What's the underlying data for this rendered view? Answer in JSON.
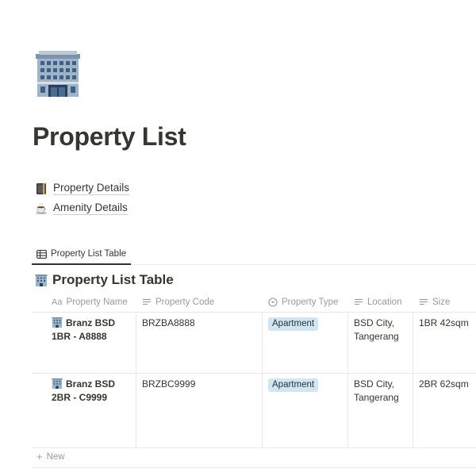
{
  "page": {
    "icon": "office-building-icon",
    "title": "Property List"
  },
  "links": [
    {
      "icon": "ledger-icon",
      "label": "Property Details"
    },
    {
      "icon": "coffee-icon",
      "label": "Amenity Details"
    }
  ],
  "tabs": [
    {
      "icon": "table-icon",
      "label": "Property List Table",
      "active": true
    }
  ],
  "database": {
    "icon": "office-building-icon",
    "title": "Property List Table",
    "columns": [
      {
        "icon": "text-aa-icon",
        "icon_text": "Aa",
        "label": "Property Name"
      },
      {
        "icon": "text-lines-icon",
        "label": "Property Code"
      },
      {
        "icon": "select-circle-icon",
        "label": "Property Type"
      },
      {
        "icon": "text-lines-icon",
        "label": "Location"
      },
      {
        "icon": "text-lines-icon",
        "label": "Size"
      }
    ],
    "rows": [
      {
        "name_line1": "Branz BSD",
        "name_line2": "1BR - A8888",
        "code": "BRZBA8888",
        "type": "Apartment",
        "location_line1": "BSD City,",
        "location_line2": "Tangerang",
        "size": "1BR 42sqm"
      },
      {
        "name_line1": "Branz BSD",
        "name_line2": "2BR - C9999",
        "code": "BRZBC9999",
        "type": "Apartment",
        "location_line1": "BSD City,",
        "location_line2": "Tangerang",
        "size": "2BR 62sqm"
      }
    ],
    "new_label": "New"
  },
  "colors": {
    "text": "#37352f",
    "muted": "#9b9a97",
    "tag_bg": "#d3e5ef",
    "tag_text": "#183347",
    "border": "#e9e9e7"
  }
}
